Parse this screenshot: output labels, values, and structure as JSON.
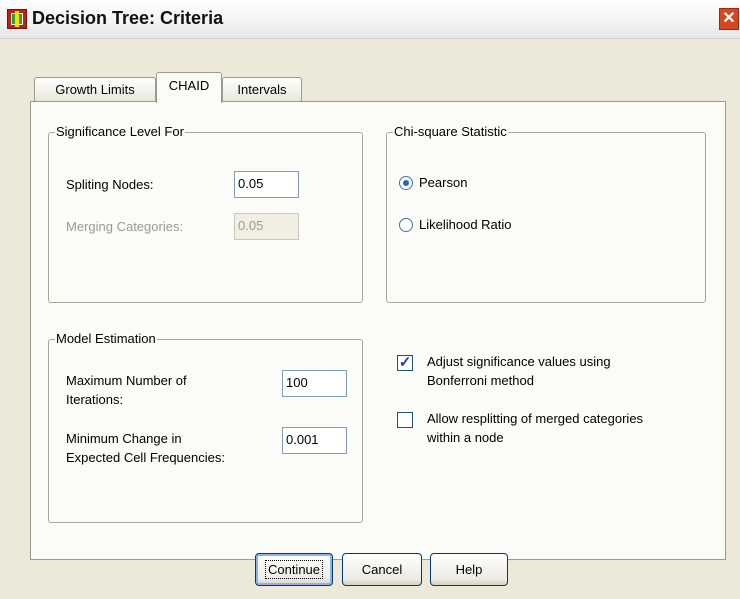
{
  "window": {
    "title": "Decision Tree: Criteria",
    "close_glyph": "✕"
  },
  "tabs": [
    {
      "label": "Growth Limits",
      "active": false
    },
    {
      "label": "CHAID",
      "active": true
    },
    {
      "label": "Intervals",
      "active": false
    }
  ],
  "significance": {
    "legend": "Significance Level For",
    "splitting_label": "Spliting Nodes:",
    "splitting_value": "0.05",
    "merging_label": "Merging Categories:",
    "merging_value": "0.05"
  },
  "chisquare": {
    "legend": "Chi-square Statistic",
    "pearson_label": "Pearson",
    "likelihood_label": "Likelihood Ratio",
    "selected": "Pearson"
  },
  "model": {
    "legend": "Model Estimation",
    "max_iter_label_1": "Maximum Number of",
    "max_iter_label_2": "Iterations:",
    "max_iter_value": "100",
    "min_change_label_1": "Minimum Change in",
    "min_change_label_2": "Expected Cell Frequencies:",
    "min_change_value": "0.001"
  },
  "options": {
    "adjust_label_1": "Adjust significance values using",
    "adjust_label_2": "Bonferroni method",
    "adjust_checked": true,
    "allow_label_1": "Allow resplitting of merged categories",
    "allow_label_2": "within a node",
    "allow_checked": false
  },
  "buttons": {
    "continue": "Continue",
    "cancel": "Cancel",
    "help": "Help"
  },
  "icons": {
    "app": "app-icon",
    "close": "close-icon"
  }
}
